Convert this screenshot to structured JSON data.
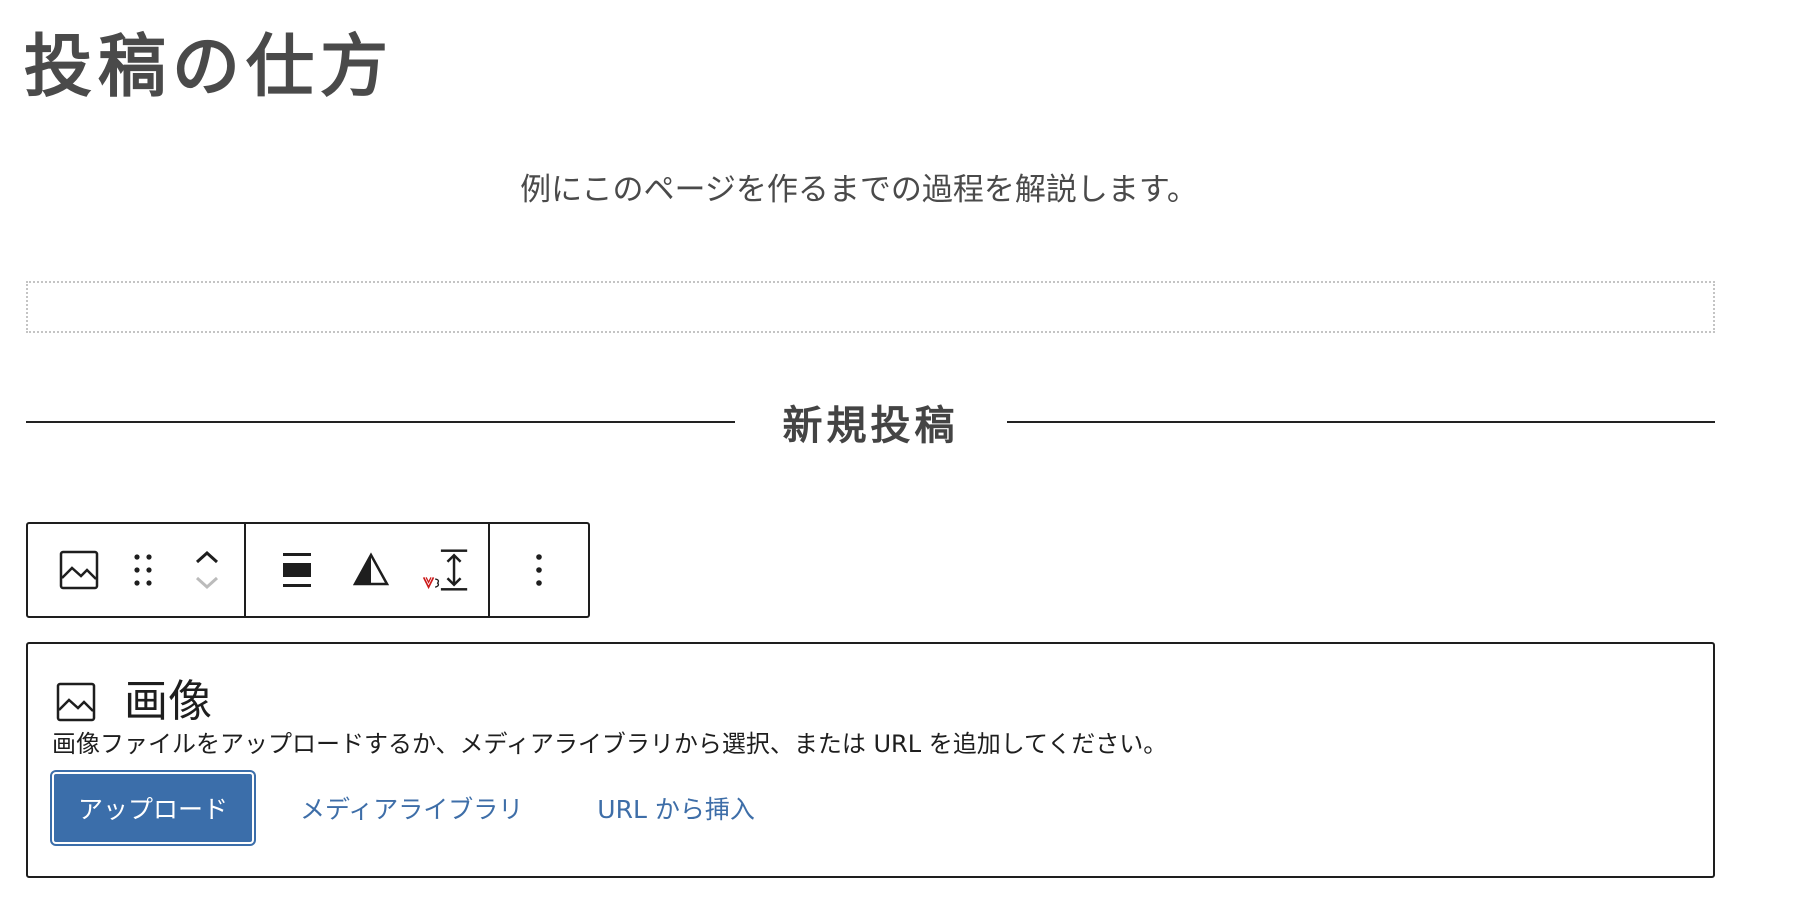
{
  "page": {
    "title": "投稿の仕方",
    "intro": "例にこのページを作るまでの過程を解説します。"
  },
  "section_heading": "新規投稿",
  "toolbar": {
    "buttons": [
      {
        "name": "image-block-icon"
      },
      {
        "name": "drag-handle-icon"
      },
      {
        "name": "move-up-icon"
      },
      {
        "name": "move-down-icon"
      },
      {
        "name": "align-icon"
      },
      {
        "name": "duotone-filter-icon"
      },
      {
        "name": "change-height-icon"
      },
      {
        "name": "more-options-icon"
      }
    ],
    "colors": {
      "border": "#1e1e1e",
      "disabled": "#bbbbbb",
      "badge": "#cc1818"
    }
  },
  "image_placeholder": {
    "label": "画像",
    "instructions": "画像ファイルをアップロードするか、メディアライブラリから選択、または URL を追加してください。",
    "upload_label": "アップロード",
    "media_library_label": "メディアライブラリ",
    "insert_url_label": "URL から挿入"
  },
  "colors": {
    "accent": "#3b6eaa",
    "link": "#3e6ea8",
    "title_text": "#4a4a4a"
  }
}
